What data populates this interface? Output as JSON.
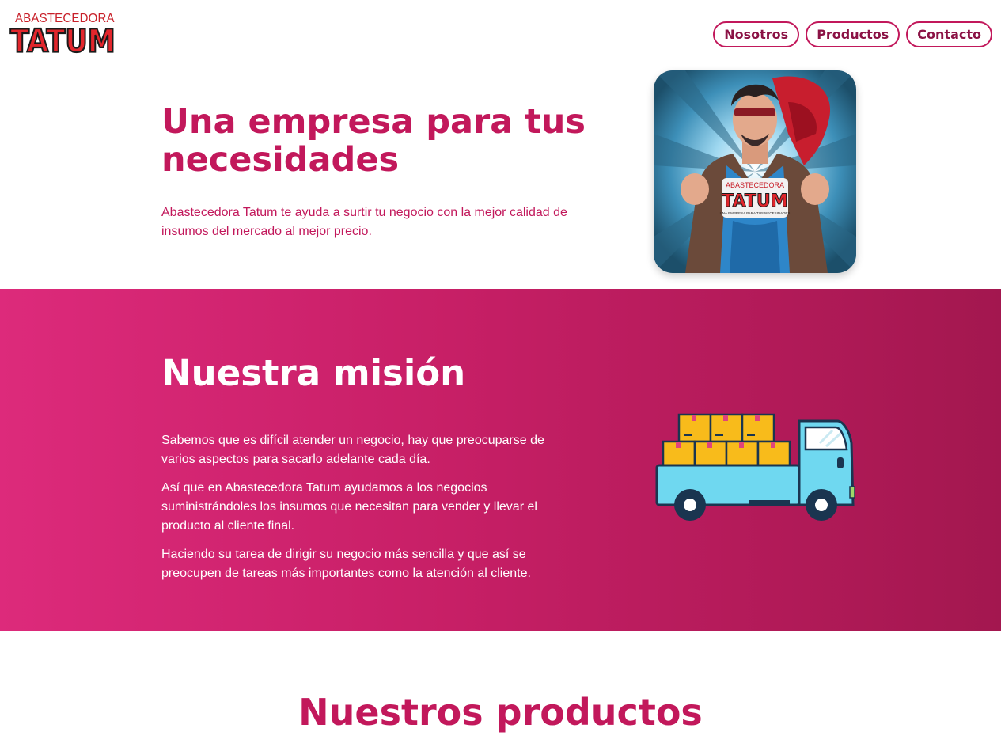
{
  "header": {
    "logo_top": "ABASTECEDORA",
    "logo_main": "TATUM",
    "nav": [
      "Nosotros",
      "Productos",
      "Contacto"
    ]
  },
  "hero": {
    "title": "Una empresa para tus necesidades",
    "text": "Abastecedora Tatum te ayuda a surtir tu negocio con la mejor calidad de insumos del mercado al mejor precio.",
    "badge_top": "ABASTECEDORA",
    "badge_main": "TATUM",
    "badge_sub": "UNA EMPRESA PARA TUS NECESIDADES"
  },
  "mission": {
    "title": "Nuestra misión",
    "paragraphs": [
      "Sabemos que es difícil atender un negocio, hay que preocuparse de varios aspectos para sacarlo adelante cada día.",
      "Así que en Abastecedora Tatum ayudamos a los negocios suministrándoles los insumos que necesitan para vender y llevar el producto al cliente final.",
      "Haciendo su tarea de dirigir su negocio más sencilla y que así se preocupen de tareas más importantes como la atención al cliente."
    ]
  },
  "products": {
    "title": "Nuestros productos"
  },
  "colors": {
    "primary": "#c2185b",
    "dark": "#8b1245",
    "gradient_start": "#dd2a7b",
    "gradient_end": "#a3174f",
    "white": "#ffffff"
  }
}
